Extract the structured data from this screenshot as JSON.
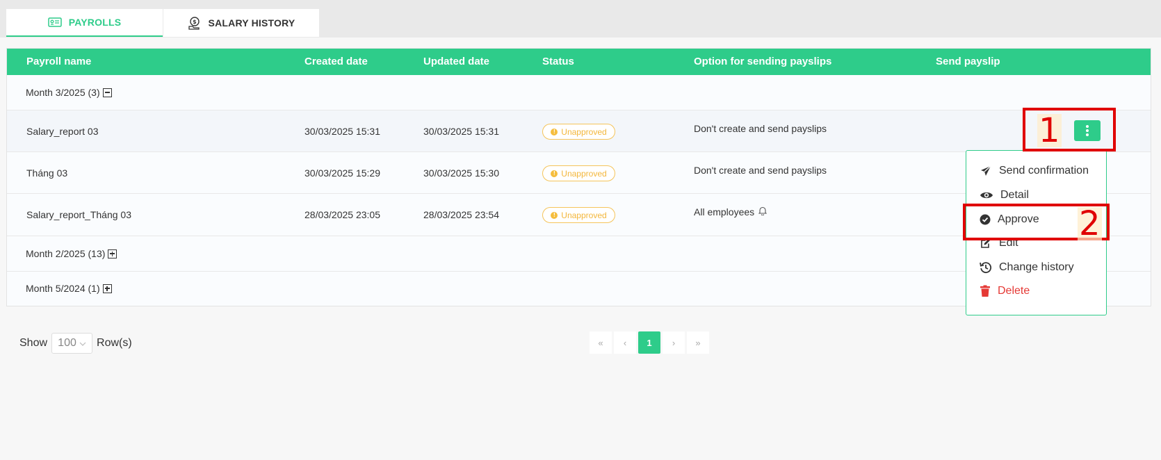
{
  "tabs": {
    "payrolls": {
      "label": "PAYROLLS",
      "icon": "payroll-card-icon"
    },
    "salary_history": {
      "label": "SALARY HISTORY",
      "icon": "money-hand-icon"
    }
  },
  "table": {
    "headers": {
      "name": "Payroll name",
      "created": "Created date",
      "updated": "Updated date",
      "status": "Status",
      "option": "Option for sending payslips",
      "send": "Send payslip"
    },
    "groups": [
      {
        "label": "Month 3/2025 (3)",
        "expanded": true
      },
      {
        "label": "Month 2/2025 (13)",
        "expanded": false
      },
      {
        "label": "Month 5/2024 (1)",
        "expanded": false
      }
    ],
    "rows": [
      {
        "name": "Salary_report 03",
        "created": "30/03/2025 15:31",
        "updated": "30/03/2025 15:31",
        "status": "Unapproved",
        "option": "Don't create and send payslips"
      },
      {
        "name": "Tháng 03",
        "created": "30/03/2025 15:29",
        "updated": "30/03/2025 15:30",
        "status": "Unapproved",
        "option": "Don't create and send payslips"
      },
      {
        "name": "Salary_report_Tháng 03",
        "created": "28/03/2025 23:05",
        "updated": "28/03/2025 23:54",
        "status": "Unapproved",
        "option": "All employees"
      }
    ]
  },
  "menu": {
    "items": [
      {
        "label": "Send confirmation",
        "icon": "paper-plane-icon"
      },
      {
        "label": "Detail",
        "icon": "eye-icon"
      },
      {
        "label": "Approve",
        "icon": "check-circle-icon"
      },
      {
        "label": "Edit",
        "icon": "edit-icon"
      },
      {
        "label": "Change history",
        "icon": "history-icon"
      },
      {
        "label": "Delete",
        "icon": "trash-icon"
      }
    ]
  },
  "annotations": {
    "marker_1": "1",
    "marker_2": "2"
  },
  "footer": {
    "show_label": "Show",
    "rows_value": "100",
    "rows_label": "Row(s)",
    "pagination": {
      "first": "«",
      "prev": "‹",
      "current": "1",
      "next": "›",
      "last": "»"
    }
  },
  "colors": {
    "accent": "#2ecc8a",
    "warning": "#f5c45a",
    "danger": "#e53935",
    "annotation": "#e00000"
  }
}
